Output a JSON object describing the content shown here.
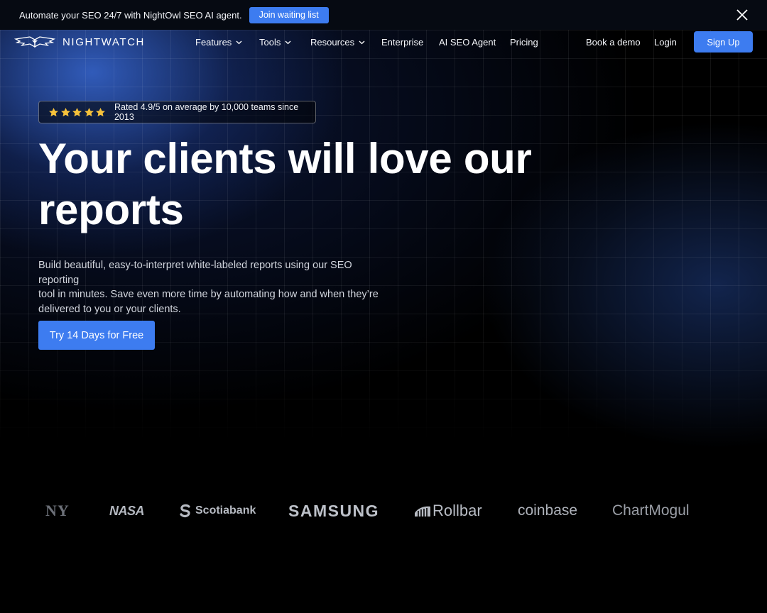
{
  "announcement": {
    "text": "Automate your SEO 24/7 with NightOwl SEO AI agent.",
    "button_label": "Join waiting list",
    "close_icon": "close-icon"
  },
  "nav": {
    "logo_text": "NIGHTWATCH",
    "logo_icon": "owl-wings-icon",
    "items": [
      {
        "label": "Features",
        "dropdown": true
      },
      {
        "label": "Tools",
        "dropdown": true
      },
      {
        "label": "Resources",
        "dropdown": true
      },
      {
        "label": "Enterprise",
        "dropdown": false
      },
      {
        "label": "AI SEO Agent",
        "dropdown": false
      },
      {
        "label": "Pricing",
        "dropdown": false
      }
    ],
    "book_demo": "Book a demo",
    "login": "Login",
    "signup": "Sign Up"
  },
  "hero": {
    "rating_text": "Rated 4.9/5 on average by 10,000 teams since 2013",
    "stars": 5,
    "headline_line1": "Your clients will love our",
    "headline_line2": "reports",
    "subcopy_line1": "Build beautiful, easy-to-interpret white-labeled reports using our SEO reporting",
    "subcopy_line2": "tool in minutes. Save even more time by automating how and when they’re",
    "subcopy_line3": "delivered to you or your clients.",
    "cta_label": "Try 14 Days for Free"
  },
  "client_logos": {
    "ny": "NY",
    "nasa": "NASA",
    "scotiabank": "Scotiabank",
    "samsung": "SAMSUNG",
    "rollbar": "Rollbar",
    "coinbase": "coinbase",
    "chartmogul": "ChartMogul"
  },
  "colors": {
    "accent": "#3d7cf0",
    "star": "#f5c13b",
    "background": "#000000"
  }
}
